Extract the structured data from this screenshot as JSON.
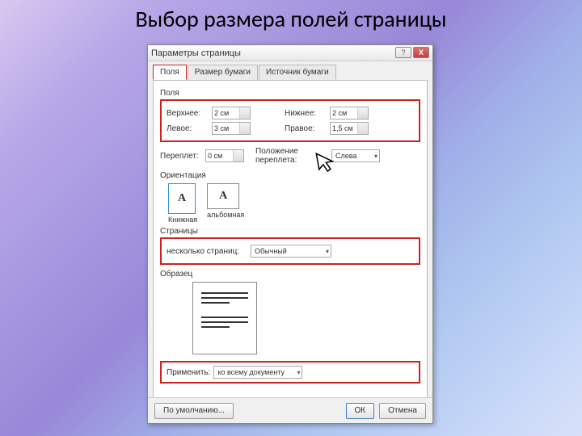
{
  "slide": {
    "title": "Выбор размера полей страницы"
  },
  "dialog": {
    "title": "Параметры страницы",
    "tabs": {
      "margins": "Поля",
      "paper": "Размер бумаги",
      "source": "Источник бумаги"
    },
    "fields_group": "Поля",
    "top": {
      "label": "Верхнее:",
      "value": "2 см"
    },
    "bottom": {
      "label": "Нижнее:",
      "value": "2 см"
    },
    "left": {
      "label": "Левое:",
      "value": "3 см"
    },
    "right": {
      "label": "Правое:",
      "value": "1,5 см"
    },
    "gutter": {
      "label": "Переплет:",
      "value": "0 см"
    },
    "gutter_pos": {
      "label": "Положение переплета:",
      "value": "Слева"
    },
    "orientation": {
      "label": "Ориентация",
      "portrait": "Книжная",
      "landscape": "альбомная"
    },
    "pages": {
      "label": "Страницы",
      "multi_label": "несколько страниц:",
      "value": "Обычный"
    },
    "sample": "Образец",
    "apply": {
      "label": "Применить:",
      "value": "ко всему документу"
    },
    "buttons": {
      "default": "По умолчанию...",
      "ok": "ОК",
      "cancel": "Отмена"
    },
    "win": {
      "help": "?",
      "close": "X"
    }
  }
}
